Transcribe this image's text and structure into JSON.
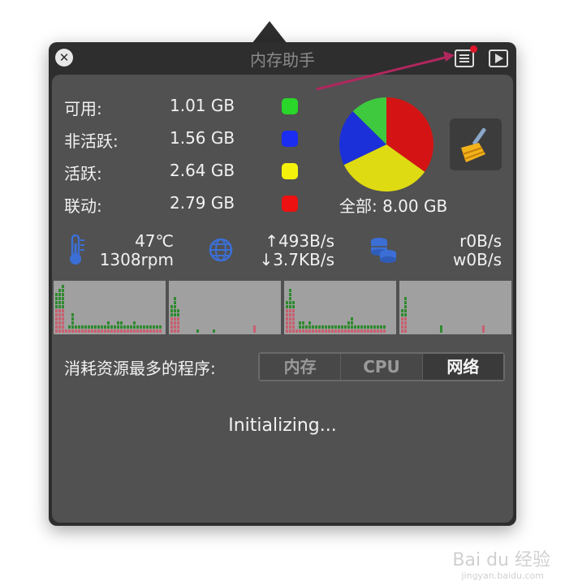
{
  "window": {
    "title": "内存助手",
    "icons": {
      "close": "close-icon",
      "menu": "menu-list-icon",
      "play": "play-icon",
      "clean": "broom-icon"
    },
    "badge_color": "#e0162b"
  },
  "memory": {
    "rows": [
      {
        "label": "可用:",
        "value": "1.01 GB",
        "color": "#29d629"
      },
      {
        "label": "非活跃:",
        "value": "1.56 GB",
        "color": "#1a2df0"
      },
      {
        "label": "活跃:",
        "value": "2.64 GB",
        "color": "#f4f20c"
      },
      {
        "label": "联动:",
        "value": "2.79 GB",
        "color": "#ee1111"
      }
    ],
    "total_label": "全部: 8.00 GB",
    "pie": {
      "total": 8.0,
      "slices": [
        {
          "value": 1.01,
          "color": "#3ec93e"
        },
        {
          "value": 1.56,
          "color": "#1b30d8"
        },
        {
          "value": 2.64,
          "color": "#dfdb12"
        },
        {
          "value": 2.79,
          "color": "#d41414"
        }
      ]
    }
  },
  "sensors": {
    "temperature": "47℃",
    "fan": "1308rpm",
    "net_up": "↑493B/s",
    "net_down": "↓3.7KB/s",
    "disk_read": "r0B/s",
    "disk_write": "w0B/s"
  },
  "top_processes": {
    "label": "消耗资源最多的程序:",
    "tabs": [
      "内存",
      "CPU",
      "网络"
    ],
    "selected_tab": "网络",
    "status": "Initializing..."
  },
  "watermark": {
    "text": "Bai du 经验",
    "url": "jingyan.baidu.com"
  }
}
